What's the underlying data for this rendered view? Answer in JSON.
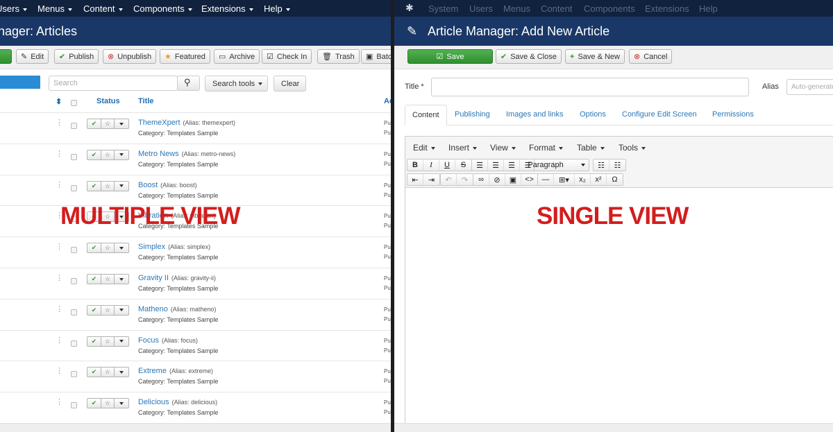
{
  "left": {
    "menu": [
      "Users",
      "Menus",
      "Content",
      "Components",
      "Extensions",
      "Help"
    ],
    "title": "nager: Articles",
    "toolbar": {
      "new": "",
      "edit": "Edit",
      "publish": "Publish",
      "unpublish": "Unpublish",
      "featured": "Featured",
      "archive": "Archive",
      "checkin": "Check In",
      "trash": "Trash",
      "batch": "Batch"
    },
    "search_placeholder": "Search",
    "search_tools": "Search tools",
    "clear": "Clear",
    "columns": {
      "status": "Status",
      "title": "Title",
      "access": "Ac"
    },
    "category_prefix": "Category:",
    "articles": [
      {
        "title": "ThemeXpert",
        "alias": "(Alias: themexpert)",
        "category": "Category: Templates Sample",
        "access": "Pu"
      },
      {
        "title": "Metro News",
        "alias": "(Alias: metro-news)",
        "category": "Category: Templates Sample",
        "access": "Pu"
      },
      {
        "title": "Boost",
        "alias": "(Alias: boost)",
        "category": "Category: Templates Sample",
        "access": "Pu"
      },
      {
        "title": "Vibration",
        "alias": "(Alias: vibration)",
        "category": "Category: Templates Sample",
        "access": "Pu"
      },
      {
        "title": "Simplex",
        "alias": "(Alias: simplex)",
        "category": "Category: Templates Sample",
        "access": "Pu"
      },
      {
        "title": "Gravity II",
        "alias": "(Alias: gravity-ii)",
        "category": "Category: Templates Sample",
        "access": "Pu"
      },
      {
        "title": "Matheno",
        "alias": "(Alias: matheno)",
        "category": "Category: Templates Sample",
        "access": "Pu"
      },
      {
        "title": "Focus",
        "alias": "(Alias: focus)",
        "category": "Category: Templates Sample",
        "access": "Pu"
      },
      {
        "title": "Extreme",
        "alias": "(Alias: extreme)",
        "category": "Category: Templates Sample",
        "access": "Pu"
      },
      {
        "title": "Delicious",
        "alias": "(Alias: delicious)",
        "category": "Category: Templates Sample",
        "access": "Pu"
      }
    ],
    "overlay": "MULTIPLE VIEW"
  },
  "right": {
    "menu": [
      "System",
      "Users",
      "Menus",
      "Content",
      "Components",
      "Extensions",
      "Help"
    ],
    "title": "Article Manager: Add New Article",
    "toolbar": {
      "save": "Save",
      "save_close": "Save & Close",
      "save_new": "Save & New",
      "cancel": "Cancel"
    },
    "title_label": "Title *",
    "alias_label": "Alias",
    "alias_placeholder": "Auto-generate from title",
    "tabs": [
      "Content",
      "Publishing",
      "Images and links",
      "Options",
      "Configure Edit Screen",
      "Permissions"
    ],
    "editor_menu": [
      "Edit",
      "Insert",
      "View",
      "Format",
      "Table",
      "Tools"
    ],
    "format_select": "Paragraph",
    "overlay": "SINGLE VIEW"
  },
  "colors": {
    "topbar": "#10223e",
    "titlebar": "#1a3867",
    "accent": "#2a77b6",
    "overlay": "#d31d1d",
    "save": "#3a9d3a"
  }
}
